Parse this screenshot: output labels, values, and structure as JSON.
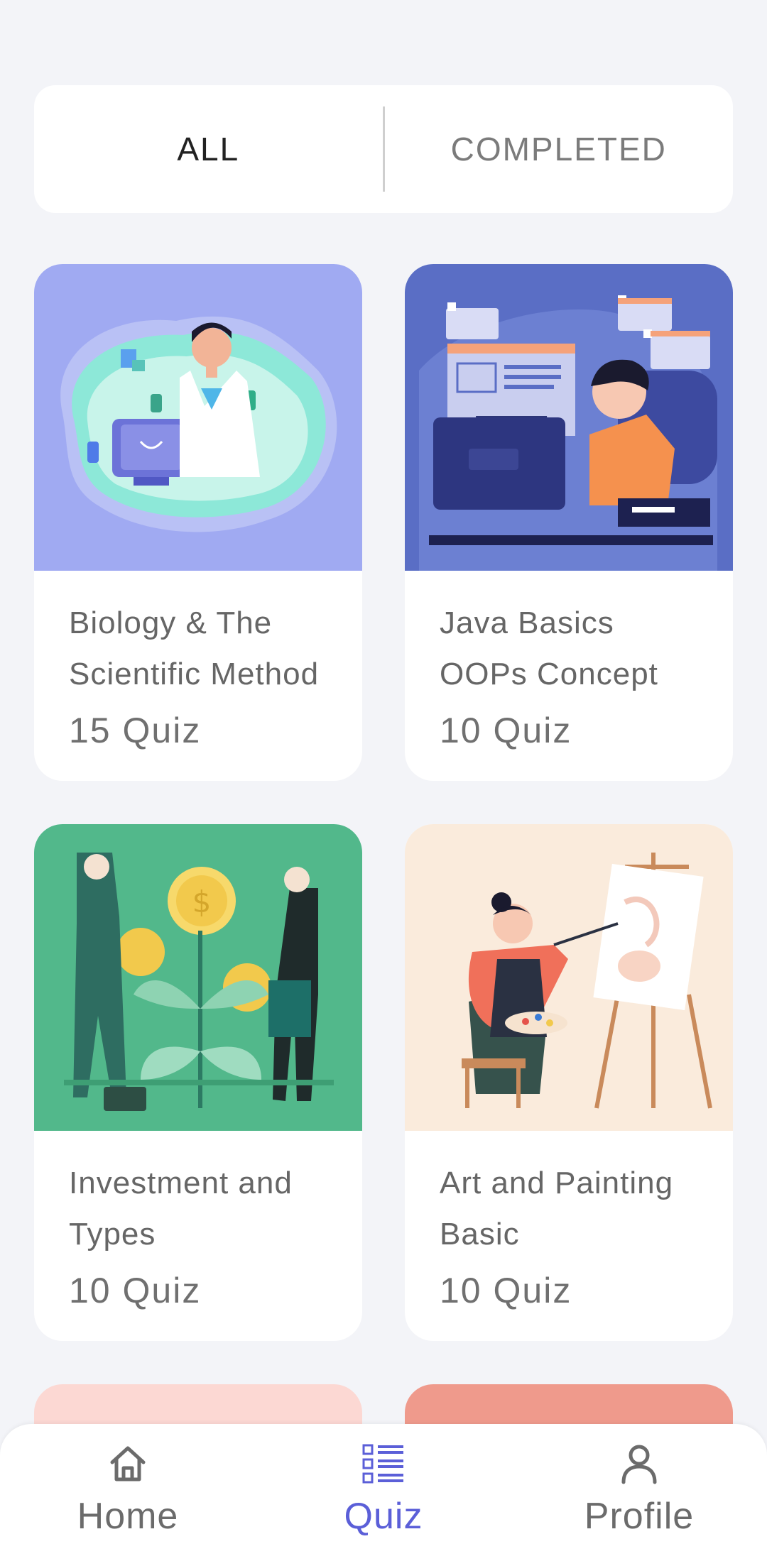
{
  "tabs": {
    "all": "ALL",
    "completed": "COMPLETED",
    "selected": "ALL"
  },
  "quizzes": [
    {
      "title": "Biology & The Scientific Method",
      "count": "15 Quiz"
    },
    {
      "title": "Java Basics OOPs Concept",
      "count": "10 Quiz"
    },
    {
      "title": "Investment and Types",
      "count": "10 Quiz"
    },
    {
      "title": "Art and Painting Basic",
      "count": "10 Quiz"
    }
  ],
  "nav": {
    "home": "Home",
    "quiz": "Quiz",
    "profile": "Profile",
    "active": "Quiz"
  },
  "colors": {
    "accent": "#5b5fd8",
    "background": "#f3f4f8"
  }
}
